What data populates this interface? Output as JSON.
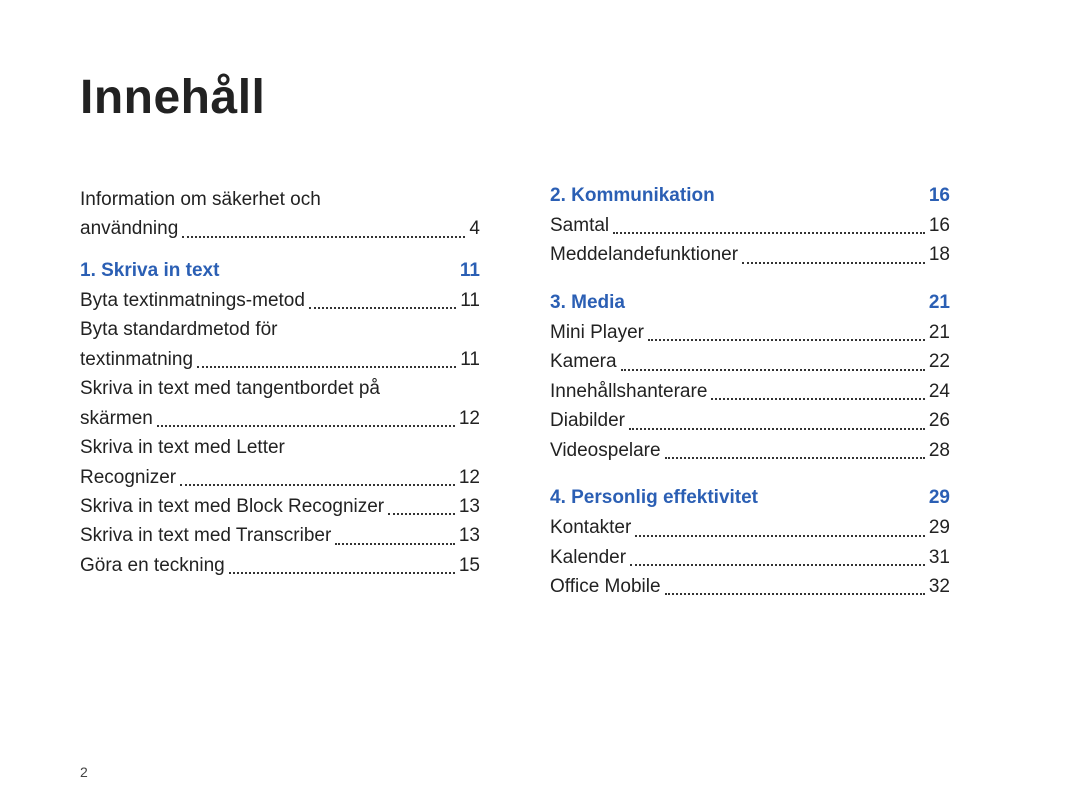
{
  "title": "Innehåll",
  "footer_page": "2",
  "left": {
    "pre": [
      {
        "label_line1": "Information om säkerhet och",
        "label_line2": "användning",
        "page": "4"
      }
    ],
    "sections": [
      {
        "heading": "1. Skriva in text",
        "page": "11",
        "entries": [
          {
            "label": "Byta textinmatnings-metod",
            "page": "11"
          },
          {
            "label_line1": "Byta standardmetod för",
            "label_line2": "textinmatning",
            "page": "11"
          },
          {
            "label_line1": "Skriva in text med tangentbordet på",
            "label_line2": "skärmen",
            "page": "12"
          },
          {
            "label_line1": "Skriva in text med Letter",
            "label_line2": "Recognizer",
            "page": "12"
          },
          {
            "label": "Skriva in text med Block Recognizer",
            "page": "13"
          },
          {
            "label": "Skriva in text med Transcriber",
            "page": "13"
          },
          {
            "label": "Göra en teckning",
            "page": "15"
          }
        ]
      }
    ]
  },
  "right": {
    "sections": [
      {
        "heading": "2. Kommunikation",
        "page": "16",
        "entries": [
          {
            "label": "Samtal",
            "page": "16"
          },
          {
            "label": "Meddelandefunktioner",
            "page": "18"
          }
        ]
      },
      {
        "heading": "3. Media",
        "page": "21",
        "entries": [
          {
            "label": "Mini Player",
            "page": "21"
          },
          {
            "label": "Kamera",
            "page": "22"
          },
          {
            "label": "Innehållshanterare",
            "page": "24"
          },
          {
            "label": "Diabilder",
            "page": "26"
          },
          {
            "label": "Videospelare",
            "page": "28"
          }
        ]
      },
      {
        "heading": "4. Personlig effektivitet",
        "page": "29",
        "entries": [
          {
            "label": "Kontakter",
            "page": "29"
          },
          {
            "label": "Kalender",
            "page": "31"
          },
          {
            "label": "Office Mobile",
            "page": "32"
          }
        ]
      }
    ]
  }
}
